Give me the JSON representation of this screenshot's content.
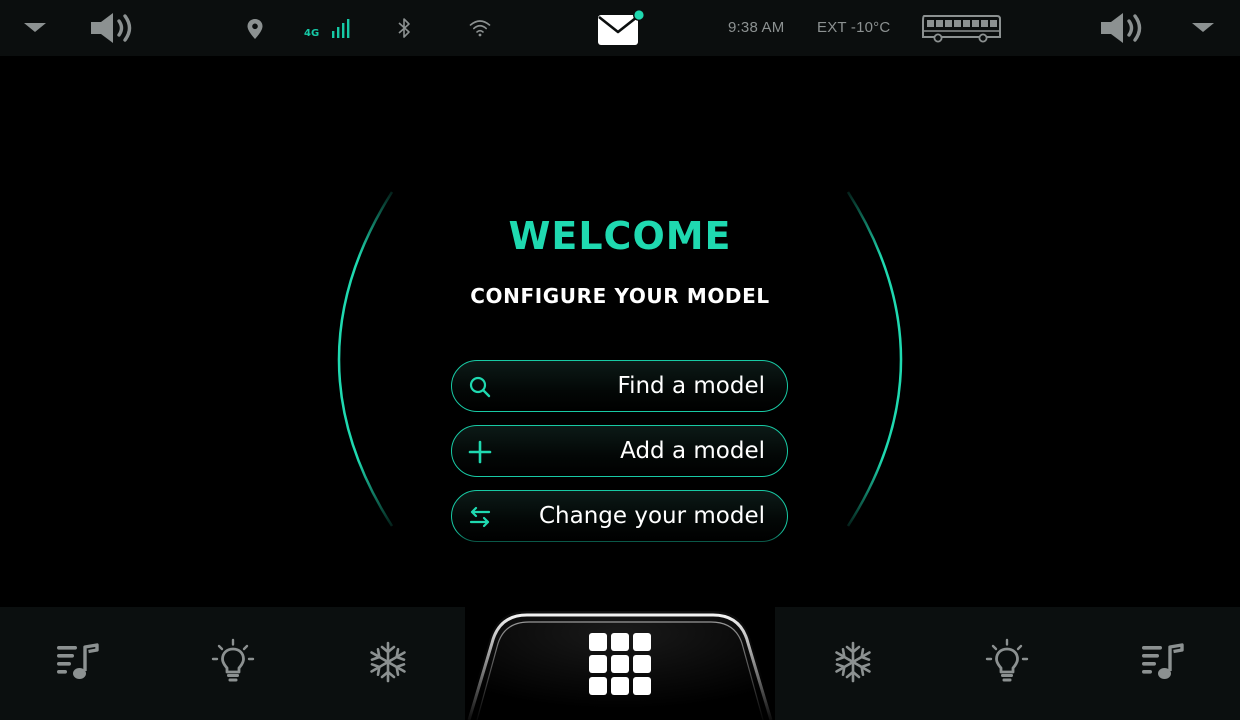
{
  "status_bar": {
    "left_chevron_icon": "chevron-down-icon",
    "left_volume_icon": "volume-icon",
    "location_icon": "location-pin-icon",
    "network_type": "4G",
    "signal_icon": "signal-bars-icon",
    "bluetooth_icon": "bluetooth-icon",
    "wifi_icon": "wifi-icon",
    "mail_icon": "mail-icon",
    "mail_badge_color": "#1fd9b0",
    "time": "9:38 AM",
    "ext_temperature": "EXT -10°C",
    "bus_icon": "bus-icon",
    "right_volume_icon": "volume-icon",
    "right_chevron_icon": "chevron-down-icon"
  },
  "welcome": {
    "title": "WELCOME",
    "subtitle": "CONFIGURE YOUR MODEL",
    "buttons": [
      {
        "label": "Find a model",
        "icon": "search-icon"
      },
      {
        "label": "Add a model",
        "icon": "plus-icon"
      },
      {
        "label": "Change your model",
        "icon": "swap-arrows-icon"
      }
    ]
  },
  "dock": {
    "items": [
      {
        "icon": "music-playlist-icon"
      },
      {
        "icon": "lightbulb-icon"
      },
      {
        "icon": "snowflake-icon"
      },
      {
        "icon": "apps-grid-icon"
      },
      {
        "icon": "snowflake-icon"
      },
      {
        "icon": "lightbulb-icon"
      },
      {
        "icon": "music-playlist-icon"
      }
    ]
  },
  "colors": {
    "accent": "#1fd9b0",
    "background": "#000000",
    "bar_background": "#0b0e0e",
    "icon_gray": "#8c9191",
    "text_white": "#ffffff"
  }
}
